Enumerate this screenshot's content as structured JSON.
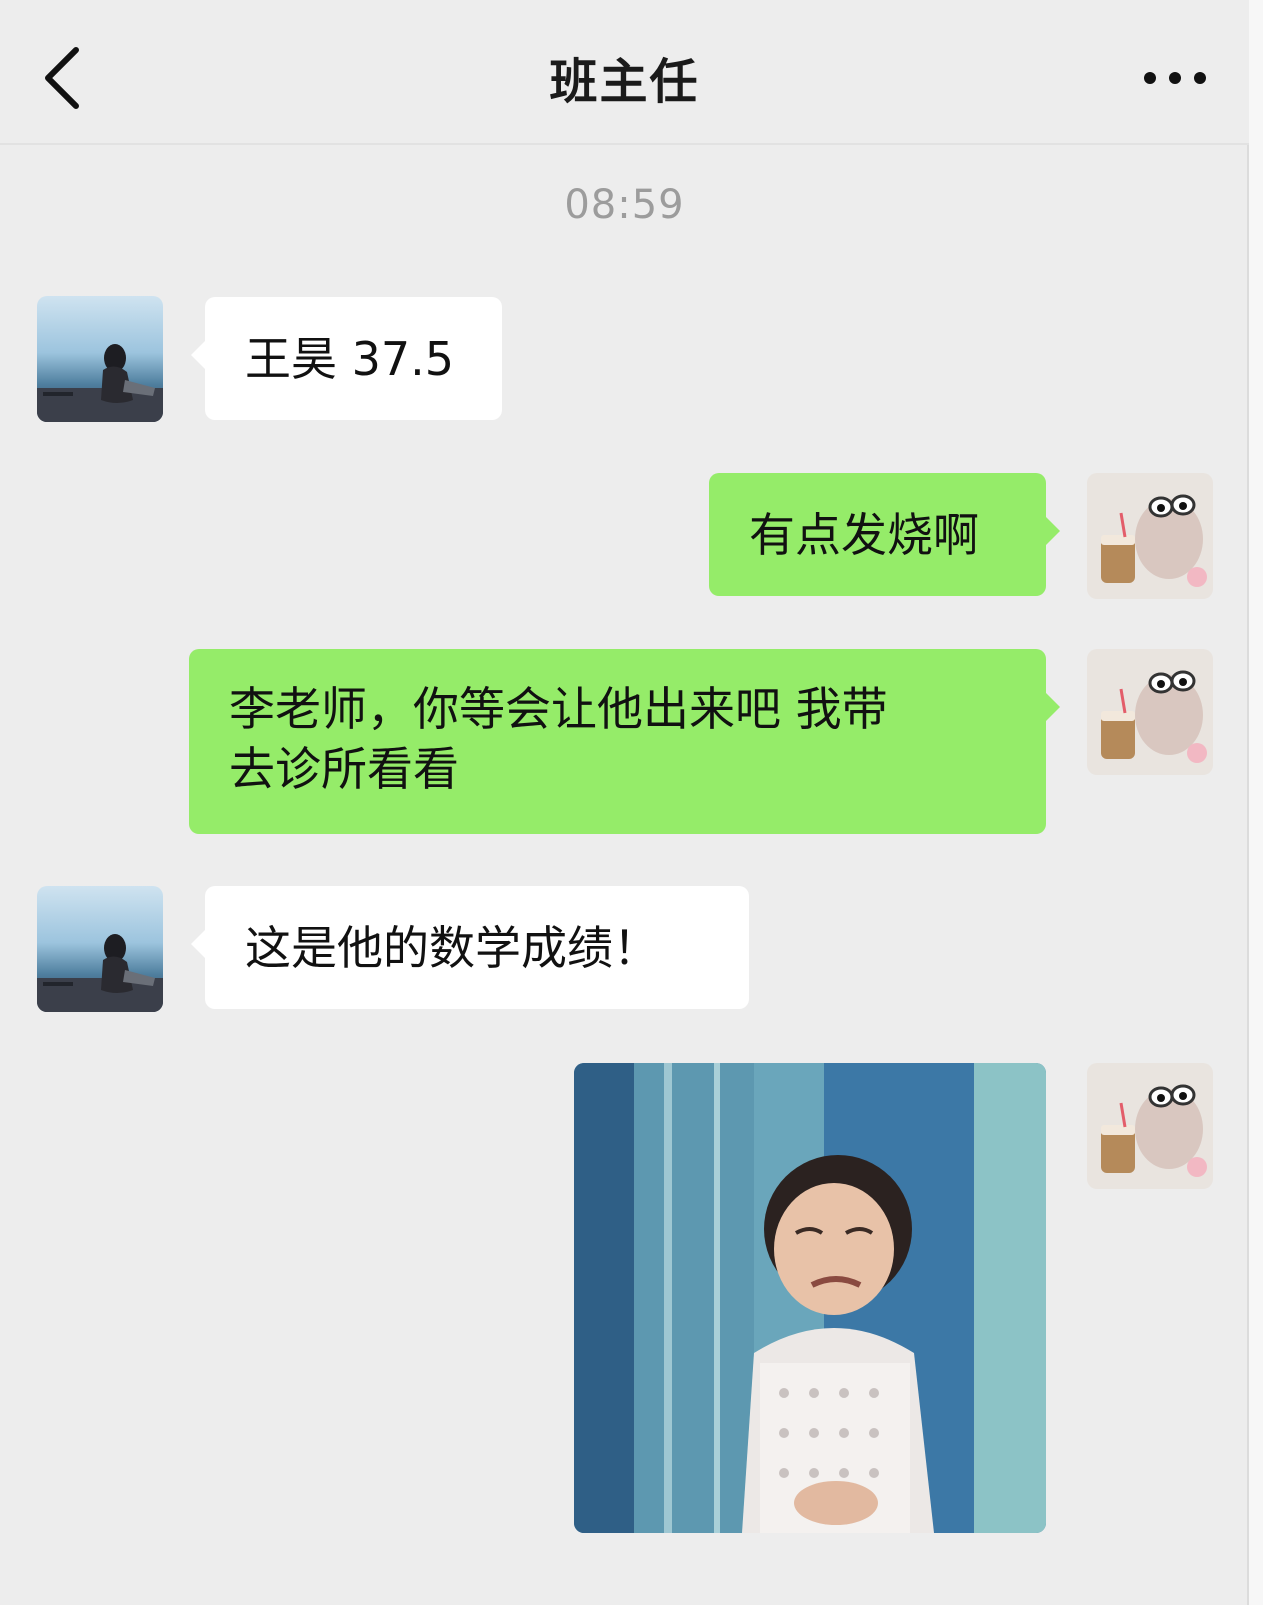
{
  "header": {
    "title": "班主任"
  },
  "timestamp": "08:59",
  "messages": [
    {
      "side": "in",
      "avatar": "woman-by-sea-avatar",
      "text": "王昊 37.5"
    },
    {
      "side": "out",
      "avatar": "toy-with-drink-avatar",
      "text": "有点发烧啊"
    },
    {
      "side": "out",
      "avatar": "toy-with-drink-avatar",
      "lines": [
        "李老师，你等会让他出来吧 我带",
        "去诊所看看"
      ]
    },
    {
      "side": "in",
      "avatar": "woman-by-sea-avatar",
      "text": "这是他的数学成绩！"
    },
    {
      "side": "out",
      "avatar": "toy-with-drink-avatar",
      "sticker": "crying-child-sticker"
    }
  ],
  "colors": {
    "background": "#ededed",
    "incoming_bubble": "#ffffff",
    "outgoing_bubble": "#95ec69",
    "timestamp": "#9c9c9c"
  },
  "icons": {
    "back": "chevron-left-icon",
    "more": "more-dots-icon"
  }
}
